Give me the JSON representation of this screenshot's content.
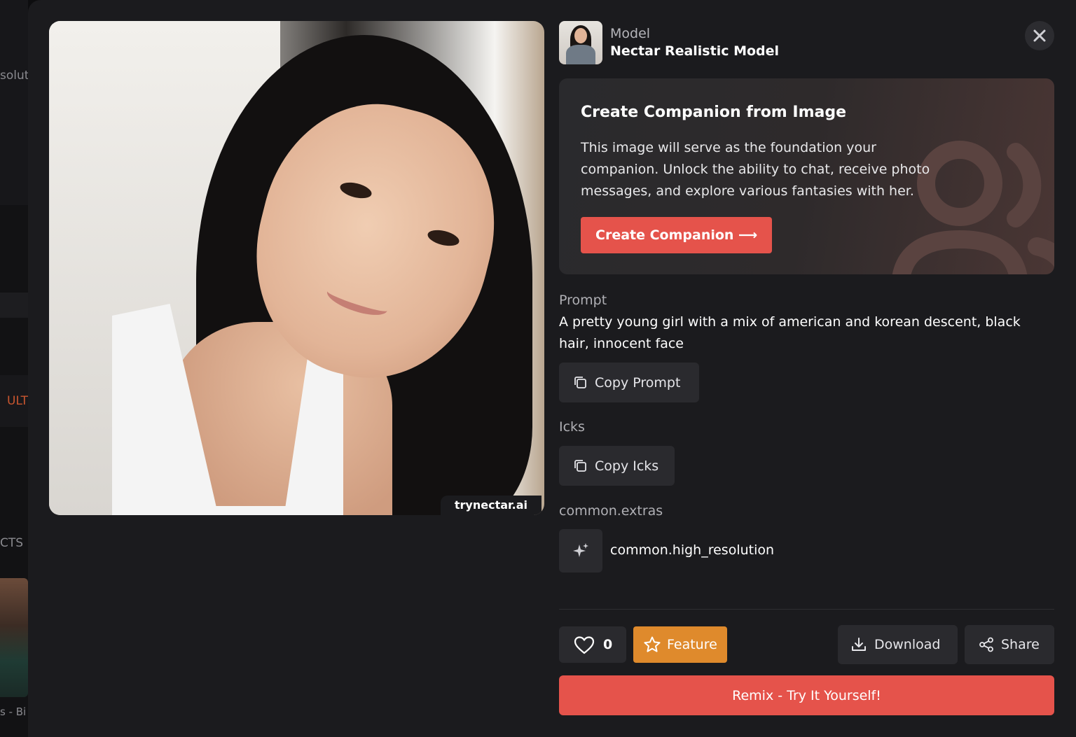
{
  "background_page": {
    "snippets": [
      "soluti",
      "ULT",
      "CTS",
      "s - Bi"
    ]
  },
  "modal": {
    "image": {
      "watermark": "trynectar.ai",
      "icon": "generated-photo"
    },
    "model": {
      "label": "Model",
      "name": "Nectar Realistic Model"
    },
    "close_icon": "close-icon",
    "companion_card": {
      "title": "Create Companion from Image",
      "description": "This image will serve as the foundation your companion. Unlock the ability to chat, receive photo messages, and explore various fantasies with her.",
      "button_label": "Create Companion ⟶"
    },
    "prompt": {
      "label": "Prompt",
      "text": "A pretty young girl with a mix of american and korean descent, black hair, innocent face",
      "copy_label": "Copy Prompt"
    },
    "icks": {
      "label": "Icks",
      "copy_label": "Copy Icks"
    },
    "extras": {
      "label": "common.extras",
      "items": [
        {
          "label": "common.high_resolution",
          "icon": "sparkles-icon"
        }
      ]
    },
    "actions": {
      "like_count": "0",
      "feature_label": "Feature",
      "download_label": "Download",
      "share_label": "Share",
      "remix_label": "Remix - Try It Yourself!"
    },
    "colors": {
      "accent_red": "#e5534b",
      "feature_orange": "#df8a2c",
      "surface": "#1b1b1e",
      "button_bg": "#2a2a2e"
    }
  }
}
